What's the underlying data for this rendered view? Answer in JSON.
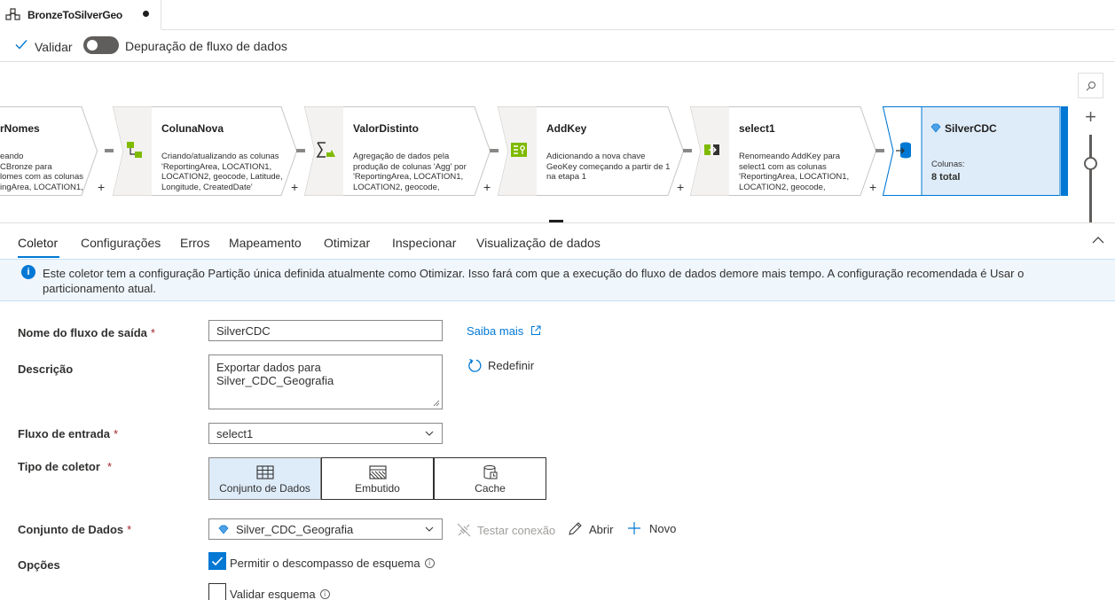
{
  "tab": {
    "title": "BronzeToSilverGeo",
    "icon": "dataflow-icon",
    "modified": true
  },
  "toolbar": {
    "validate_label": "Validar",
    "debug_label": "Depuração de fluxo de dados",
    "debug_on": false
  },
  "nodes": [
    {
      "title": "rNomes",
      "desc": "eando\nCBronze para\nlomes com as colunas\ningArea, LOCATION1,",
      "icon": ""
    },
    {
      "title": "ColunaNova",
      "desc": "Criando/atualizando as colunas 'ReportingArea, LOCATION1, LOCATION2, geocode, Latitude, Longitude, CreatedDate'",
      "icon": "derived-column-icon"
    },
    {
      "title": "ValorDistinto",
      "desc": "Agregação de dados pela produção de colunas 'Agg' por 'ReportingArea, LOCATION1, LOCATION2, geocode,",
      "icon": "aggregate-icon"
    },
    {
      "title": "AddKey",
      "desc": "Adicionando a nova chave GeoKey começando a partir de 1 na etapa 1",
      "icon": "surrogate-key-icon"
    },
    {
      "title": "select1",
      "desc": "Renomeando AddKey para select1 com as colunas 'ReportingArea, LOCATION1, LOCATION2, geocode,",
      "icon": "select-icon"
    },
    {
      "title": "SilverCDC",
      "columns_label": "Colunas:",
      "columns_value": "8 total",
      "icon": "sink-icon"
    }
  ],
  "property_tabs": [
    "Coletor",
    "Configurações",
    "Erros",
    "Mapeamento",
    "Otimizar",
    "Inspecionar",
    "Visualização de dados"
  ],
  "info_message": "Este coletor tem a configuração Partição única definida atualmente como Otimizar. Isso fará com que a execução do fluxo de dados demore mais tempo. A configuração recomendada é Usar o particionamento atual.",
  "form": {
    "output_stream_label": "Nome do fluxo de saída",
    "output_stream_value": "SilverCDC",
    "learn_more": "Saiba mais",
    "description_label": "Descrição",
    "description_value": "Exportar dados para Silver_CDC_Geografia",
    "reset_label": "Redefinir",
    "input_stream_label": "Fluxo de entrada",
    "input_stream_value": "select1",
    "sink_type_label": "Tipo de coletor",
    "sink_types": [
      "Conjunto de Dados",
      "Embutido",
      "Cache"
    ],
    "sink_type_selected": "Conjunto de Dados",
    "dataset_label": "Conjunto de Dados",
    "dataset_value": "Silver_CDC_Geografia",
    "test_connection": "Testar conexão",
    "open": "Abrir",
    "new": "Novo",
    "options_label": "Opções",
    "allow_schema_drift": "Permitir o descompasso de esquema",
    "allow_schema_drift_checked": true,
    "validate_schema": "Validar esquema",
    "validate_schema_checked": false,
    "required_mark": "*"
  }
}
